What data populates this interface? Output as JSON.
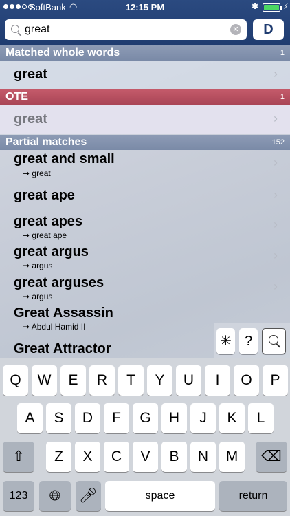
{
  "status": {
    "carrier": "SoftBank",
    "time": "12:15 PM"
  },
  "search": {
    "query": "great",
    "dictionary_button": "D"
  },
  "sections": [
    {
      "title": "Matched whole words",
      "count": "1",
      "rows": [
        {
          "word": "great"
        }
      ]
    },
    {
      "title": "OTE",
      "count": "1",
      "rows": [
        {
          "word": "great"
        }
      ]
    },
    {
      "title": "Partial matches",
      "count": "152",
      "rows": [
        {
          "word": "great and small",
          "ref": "➞ great"
        },
        {
          "word": "great ape"
        },
        {
          "word": "great apes",
          "ref": "➞ great ape"
        },
        {
          "word": "great argus",
          "ref": "➞ argus"
        },
        {
          "word": "great arguses",
          "ref": "➞ argus"
        },
        {
          "word": "Great Assassin",
          "ref": "➞ Abdul Hamid II"
        },
        {
          "word": "Great Attractor"
        }
      ]
    }
  ],
  "wildcards": [
    "✳",
    "?"
  ],
  "keyboard": {
    "row1": [
      "Q",
      "W",
      "E",
      "R",
      "T",
      "Y",
      "U",
      "I",
      "O",
      "P"
    ],
    "row2": [
      "A",
      "S",
      "D",
      "F",
      "G",
      "H",
      "J",
      "K",
      "L"
    ],
    "row3": [
      "Z",
      "X",
      "C",
      "V",
      "B",
      "N",
      "M"
    ],
    "numbers_key": "123",
    "space_key": "space",
    "return_key": "return"
  }
}
